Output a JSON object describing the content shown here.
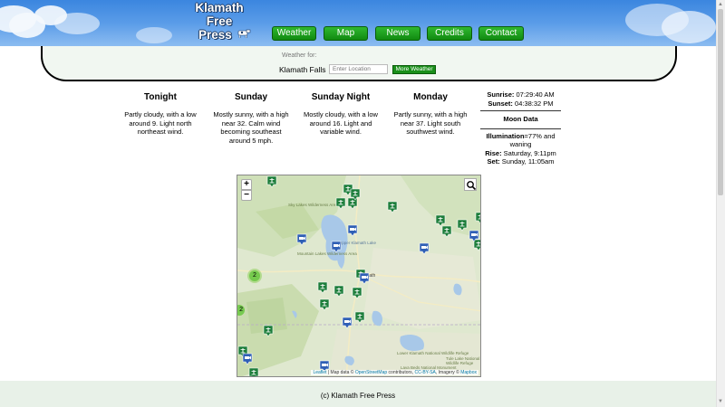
{
  "logo": {
    "line1": "Klamath",
    "line2": "Free",
    "line3": "Press"
  },
  "nav": [
    {
      "label": "Weather"
    },
    {
      "label": "Map"
    },
    {
      "label": "News"
    },
    {
      "label": "Credits"
    },
    {
      "label": "Contact"
    }
  ],
  "search": {
    "heading": "Weather for:",
    "location": "Klamath Falls",
    "placeholder": "Enter Location",
    "button": "More Weather"
  },
  "forecast": [
    {
      "title": "Tonight",
      "text": "Partly cloudy, with a low around 9. Light north northeast wind."
    },
    {
      "title": "Sunday",
      "text": "Mostly sunny, with a high near 32. Calm wind becoming southeast around 5 mph."
    },
    {
      "title": "Sunday Night",
      "text": "Mostly cloudy, with a low around 16. Light and variable wind."
    },
    {
      "title": "Monday",
      "text": "Partly sunny, with a high near 37. Light south southwest wind."
    }
  ],
  "sun": {
    "sunrise_label": "Sunrise:",
    "sunrise": "07:29:40 AM",
    "sunset_label": "Sunset:",
    "sunset": "04:38:32 PM"
  },
  "moon": {
    "heading": "Moon Data",
    "illum_label": "Illumination",
    "illum": "=77% and waning",
    "rise_label": "Rise:",
    "rise": "Saturday, 9:11pm",
    "set_label": "Set:",
    "set": "Sunday, 11:05am"
  },
  "map": {
    "zoom_in": "+",
    "zoom_out": "−",
    "cluster_a": "2",
    "cluster_b": "2",
    "attr_leaflet": "Leaflet",
    "attr_mid": " | Map data © ",
    "attr_osm": "OpenStreetMap",
    "attr_contrib": " contributors, ",
    "attr_cc": "CC-BY-SA",
    "attr_imagery": ", Imagery © ",
    "attr_mapbox": "Mapbox",
    "labels": {
      "l1": "Upper Klamath Lake",
      "l2": "Mountain Lakes Wilderness Area",
      "l3": "Lower Klamath National Wildlife Refuge",
      "l4": "Tule Lake National Wildlife Refuge",
      "l5": "Lava Beds National Monument",
      "l6": "Sky Lakes Wilderness Area",
      "l7": "Klamath"
    },
    "icons": {
      "camera": "camera-marker-icon",
      "station": "weather-station-marker-icon",
      "search": "search-icon"
    }
  },
  "footer": {
    "text": "(c) Klamath Free Press"
  },
  "colors": {
    "nav_green": "#1a9a1a",
    "sky_blue": "#3b86df",
    "panel_bg": "#f1f7f1",
    "marker_green": "#1c7d3a",
    "marker_blue": "#2f5fb5"
  }
}
